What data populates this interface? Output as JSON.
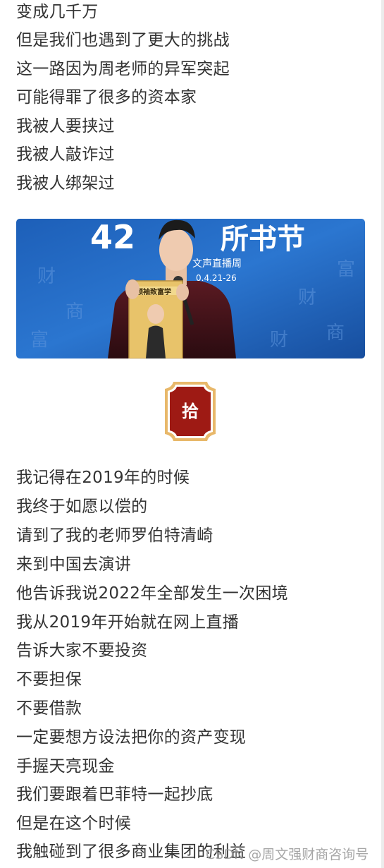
{
  "section1": {
    "lines": [
      "变成几千万",
      "但是我们也遇到了更大的挑战",
      "这一路因为周老师的异军突起",
      "可能得罪了很多的资本家",
      "我被人要挟过",
      "我被人敲诈过",
      "我被人绑架过"
    ]
  },
  "photo": {
    "banner_text": "42",
    "banner_suffix": "所书节",
    "banner_sub": "文声直播周",
    "banner_date": "0.4.21-26",
    "book_title": "领袖致富学"
  },
  "badge": {
    "char": "拾",
    "color": "#9e1a14",
    "border_color": "#e8b86a"
  },
  "section2": {
    "lines": [
      "我记得在2019年的时候",
      "我终于如愿以偿的",
      "请到了我的老师罗伯特清崎",
      "来到中国去演讲",
      "他告诉我说2022年全部发生一次困境",
      "我从2019年开始就在网上直播",
      "告诉大家不要投资",
      "不要担保",
      "不要借款",
      "一定要想方设法把你的资产变现",
      "手握天亮现金",
      "我们要跟着巴菲特一起抄底",
      "但是在这个时候",
      "我触碰到了很多商业集团的利益"
    ]
  },
  "watermark": "CSDN @周文强财商咨询号"
}
